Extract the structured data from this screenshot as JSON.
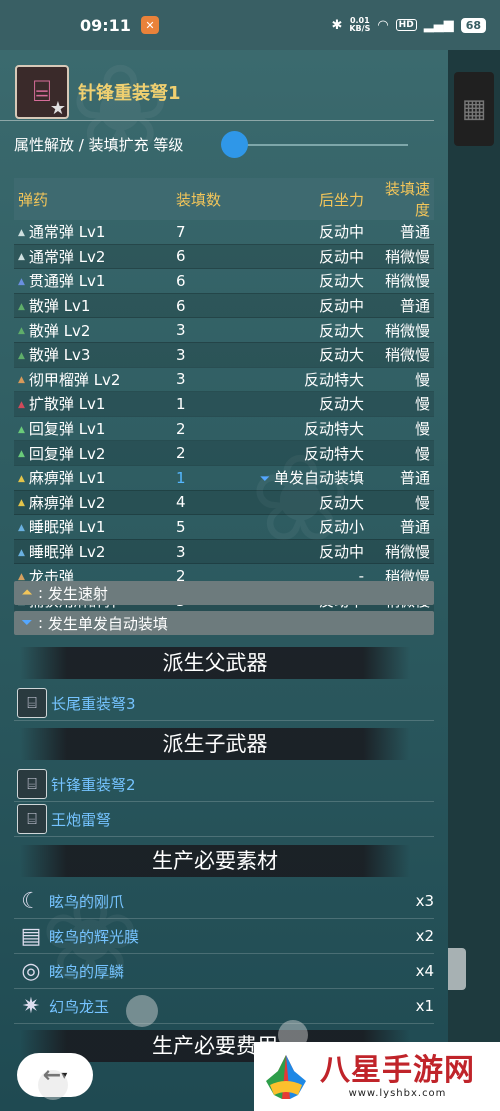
{
  "status_bar": {
    "time": "09:11",
    "speed_value": "0.01",
    "speed_unit": "KB/S",
    "hd": "HD",
    "battery": "68"
  },
  "weapon": {
    "name": "针锋重装弩1"
  },
  "level_label": "属性解放 / 装填扩充 等级",
  "ammo_table": {
    "headers": [
      "弹药",
      "装填数",
      "后坐力",
      "装填速度"
    ],
    "rows": [
      {
        "name": "通常弹 Lv1",
        "count": "7",
        "recoil": "反动中",
        "speed": "普通",
        "color": "#cfe0e0"
      },
      {
        "name": "通常弹 Lv2",
        "count": "6",
        "recoil": "反动中",
        "speed": "稍微慢",
        "color": "#cfe0e0"
      },
      {
        "name": "贯通弹 Lv1",
        "count": "6",
        "recoil": "反动大",
        "speed": "稍微慢",
        "color": "#6a8fe0"
      },
      {
        "name": "散弹 Lv1",
        "count": "6",
        "recoil": "反动中",
        "speed": "普通",
        "color": "#5fae6a"
      },
      {
        "name": "散弹 Lv2",
        "count": "3",
        "recoil": "反动大",
        "speed": "稍微慢",
        "color": "#5fae6a"
      },
      {
        "name": "散弹 Lv3",
        "count": "3",
        "recoil": "反动大",
        "speed": "稍微慢",
        "color": "#5fae6a"
      },
      {
        "name": "彻甲榴弹 Lv2",
        "count": "3",
        "recoil": "反动特大",
        "speed": "慢",
        "color": "#d99a5a"
      },
      {
        "name": "扩散弹 Lv1",
        "count": "1",
        "recoil": "反动大",
        "speed": "慢",
        "color": "#d04a5a"
      },
      {
        "name": "回复弹 Lv1",
        "count": "2",
        "recoil": "反动特大",
        "speed": "慢",
        "color": "#6acb7a"
      },
      {
        "name": "回复弹 Lv2",
        "count": "2",
        "recoil": "反动特大",
        "speed": "慢",
        "color": "#6acb7a"
      },
      {
        "name": "麻痹弹 Lv1",
        "count": "1",
        "recoil": "单发自动装填",
        "speed": "普通",
        "color": "#e3c44a",
        "auto_reload": true
      },
      {
        "name": "麻痹弹 Lv2",
        "count": "4",
        "recoil": "反动大",
        "speed": "慢",
        "color": "#e3c44a"
      },
      {
        "name": "睡眠弹 Lv1",
        "count": "5",
        "recoil": "反动小",
        "speed": "普通",
        "color": "#6ab0e0"
      },
      {
        "name": "睡眠弹 Lv2",
        "count": "3",
        "recoil": "反动中",
        "speed": "稍微慢",
        "color": "#6ab0e0"
      },
      {
        "name": "龙击弹",
        "count": "2",
        "recoil": "-",
        "speed": "稍微慢",
        "color": "#d6a060"
      },
      {
        "name": "捕获用麻醉弹",
        "count": "3",
        "recoil": "反动中",
        "speed": "稍微慢",
        "color": "#cfe0e0"
      }
    ]
  },
  "legend": {
    "rapid_fire": "发生速射",
    "single_auto_reload": "发生单发自动装填"
  },
  "sections": {
    "parent": "派生父武器",
    "children": "派生子武器",
    "materials": "生产必要素材",
    "cost_partial": "生产必要费用"
  },
  "parent_weapons": [
    {
      "name": "长尾重装弩3"
    }
  ],
  "child_weapons": [
    {
      "name": "针锋重装弩2"
    },
    {
      "name": "王炮雷弩"
    }
  ],
  "materials": [
    {
      "name": "眩鸟的刚爪",
      "qty": "x3",
      "icon": "claw-icon"
    },
    {
      "name": "眩鸟的辉光膜",
      "qty": "x2",
      "icon": "membrane-icon"
    },
    {
      "name": "眩鸟的厚鳞",
      "qty": "x4",
      "icon": "scale-icon"
    },
    {
      "name": "幻鸟龙玉",
      "qty": "x1",
      "icon": "gem-icon"
    }
  ],
  "watermark": {
    "main": "八星手游网",
    "url": "www.lyshbx.com"
  }
}
